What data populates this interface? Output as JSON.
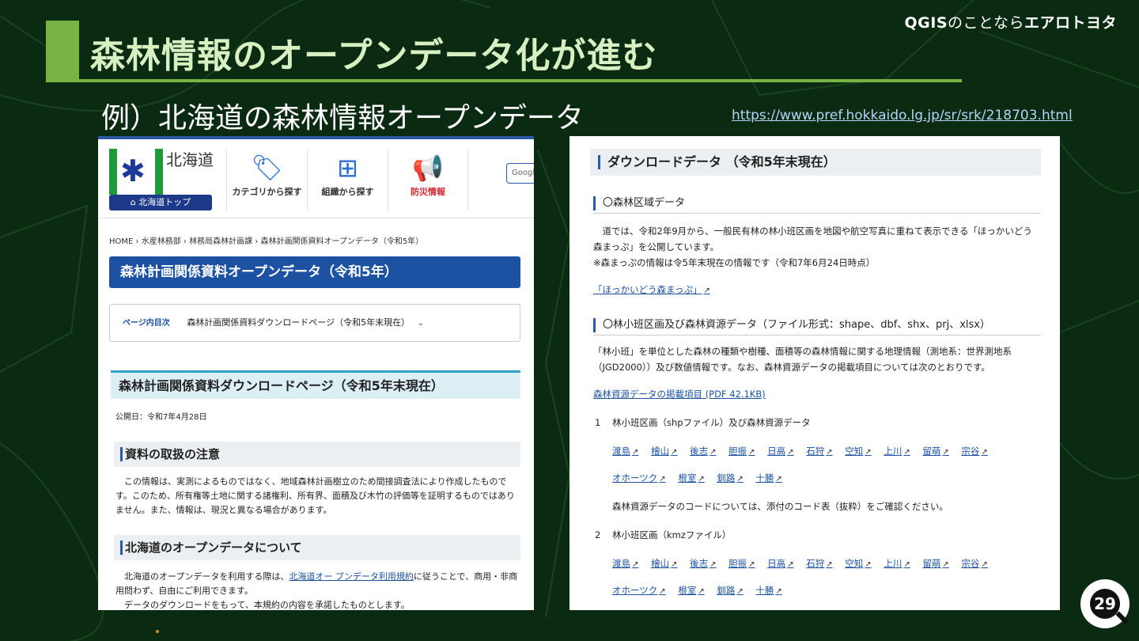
{
  "slide": {
    "brand_prefix": "QGIS",
    "brand_mid": "のことなら",
    "brand_name": "エアロトヨタ",
    "title": "森林情報のオープンデータ化が進む",
    "subtitle": "例）北海道の森林情報オープンデータ",
    "url": "https://www.pref.hokkaido.lg.jp/sr/srk/218703.html",
    "page_number": "29"
  },
  "colors": {
    "accent_green": "#78b443",
    "link_blue": "#1d52a3",
    "header_blue": "#1d52a3"
  },
  "left": {
    "site_name": "北海道",
    "home_button": "北海道トップ",
    "nav": [
      {
        "label": "カテゴリから探す",
        "icon": "tag-icon"
      },
      {
        "label": "組織から探す",
        "icon": "org-chart-icon"
      },
      {
        "label": "防災情報",
        "icon": "megaphone-icon"
      }
    ],
    "search_label": "Google",
    "breadcrumb": [
      "HOME",
      "水産林務部",
      "林務局森林計画課",
      "森林計画関係資料オープンデータ（令和5年）"
    ],
    "breadcrumb_sep": "›",
    "page_title": "森林計画関係資料オープンデータ（令和5年）",
    "toc_label": "ページ内目次",
    "toc_item": "森林計画関係資料ダウンロードページ（令和5年末現在）",
    "section_title": "森林計画関係資料ダウンロードページ（令和5年末現在）",
    "pub_date": "公開日：令和7年4月28日",
    "h3_notice": "資料の取扱の注意",
    "notice_text": "　この情報は、実測によるものではなく、地域森林計画樹立のため間接調査法により作成したものです。このため、所有権等土地に関する諸権利、所有界、面積及び木竹の評価等を証明するものではありません。また、情報は、現況と異なる場合があります。",
    "h3_open": "北海道のオープンデータについて",
    "open_text_1": "　北海道のオープンデータを利用する際は、",
    "open_link": "北海道オー プンデータ利用規約",
    "open_text_2": "に従うことで、商用・非商用問わず、自由にご利用できます。",
    "open_text_3": "　データのダウンロードをもって、本規約の内容を承諾したものとします。"
  },
  "right": {
    "h2": "ダウンロードデータ （令和5年末現在）",
    "h3_area": "〇森林区域データ",
    "area_text": "　道では、令和2年9月から、一般民有林の林小班区画を地図や航空写真に重ねて表示できる「ほっかいどう森まっぷ」を公開しています。",
    "area_note": "※森まっぷの情報は令5年末現在の情報です（令和7年6月24日時点）",
    "map_link": "「ほっかいどう森まっぷ」",
    "h3_compartment": "〇林小班区画及び森林資源データ（ファイル形式：shape、dbf、shx、prj、xlsx）",
    "comp_text": "「林小班」を単位とした森林の種類や樹種、面積等の森林情報に関する地理情報（測地系：世界測地系（JGD2000））及び数値情報です。なお、森林資源データの掲載項目については次のとおりです。",
    "items_link": "森林資源データの掲載項目 (PDF 42.1KB)",
    "item1_num": "1",
    "item1_label": "林小班区画（shpファイル）及び森林資源データ",
    "regions": [
      "渡島",
      "檜山",
      "後志",
      "胆振",
      "日高",
      "石狩",
      "空知",
      "上川",
      "留萌",
      "宗谷"
    ],
    "regions2": [
      "オホーツク",
      "根室",
      "釧路",
      "十勝"
    ],
    "code_note": "森林資源データのコードについては、添付のコード表（抜粋）をご確認ください。",
    "item2_num": "2",
    "item2_label": "林小班区画（kmzファイル）"
  }
}
